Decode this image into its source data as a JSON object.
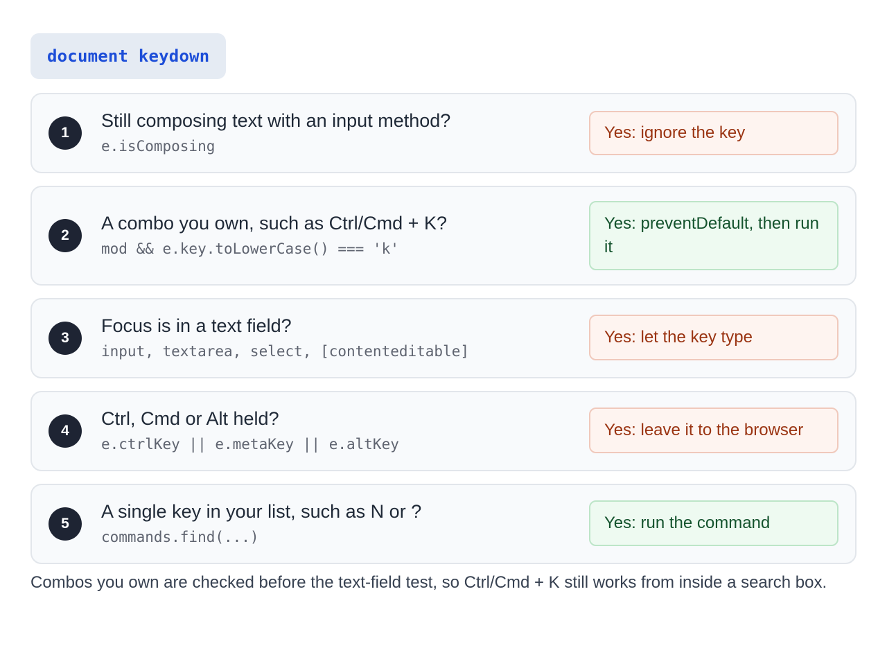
{
  "header": {
    "label": "document keydown"
  },
  "steps": [
    {
      "number": "1",
      "question": "Still composing text with an input method?",
      "code": "e.isComposing",
      "answer": "Yes: ignore the key",
      "answer_type": "stop",
      "answer_color": "#9a3412"
    },
    {
      "number": "2",
      "question": "A combo you own, such as Ctrl/Cmd + K?",
      "code": "mod && e.key.toLowerCase() === 'k'",
      "answer": "Yes: preventDefault, then run it",
      "answer_type": "go",
      "answer_color": "#14532d"
    },
    {
      "number": "3",
      "question": "Focus is in a text field?",
      "code": "input, textarea, select, [contenteditable]",
      "answer": "Yes: let the key type",
      "answer_type": "stop",
      "answer_color": "#9a3412"
    },
    {
      "number": "4",
      "question": "Ctrl, Cmd or Alt held?",
      "code": "e.ctrlKey || e.metaKey || e.altKey",
      "answer": "Yes: leave it to the browser",
      "answer_type": "stop",
      "answer_color": "#9a3412"
    },
    {
      "number": "5",
      "question": "A single key in your list, such as N or ?",
      "code": "commands.find(...)",
      "answer": "Yes: run the command",
      "answer_type": "go",
      "answer_color": "#14532d"
    }
  ],
  "footnote": "Combos you own are checked before the text-field test, so Ctrl/Cmd + K still works from inside a search box."
}
